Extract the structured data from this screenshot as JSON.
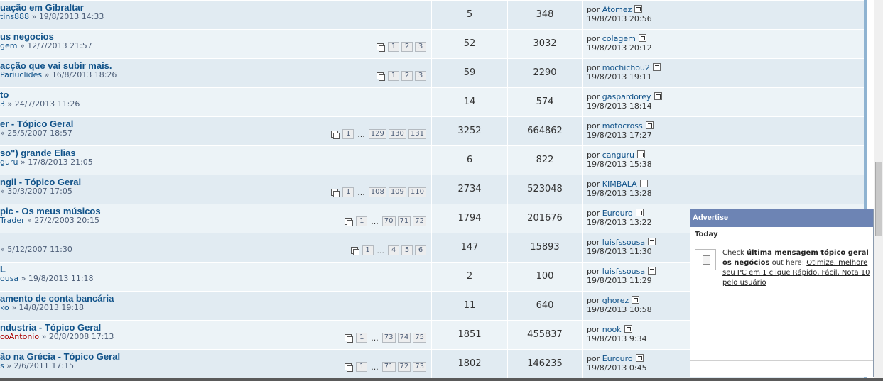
{
  "topics": [
    {
      "title": "uação em Gibraltar",
      "author": "tins888",
      "date": "19/8/2013 14:33",
      "pages": [],
      "replies": "5",
      "views": "348",
      "last_user": "Atomez",
      "last_time": "19/8/2013 20:56"
    },
    {
      "title": "us negocios",
      "author": "gem",
      "date": "12/7/2013 21:57",
      "pages": [
        "1",
        "2",
        "3"
      ],
      "replies": "52",
      "views": "3032",
      "last_user": "colagem",
      "last_time": "19/8/2013 20:12"
    },
    {
      "title": "acção que vai subir mais.",
      "author": "Pariuclides",
      "date": "16/8/2013 18:26",
      "pages": [
        "1",
        "2",
        "3"
      ],
      "replies": "59",
      "views": "2290",
      "last_user": "mochichou2",
      "last_time": "19/8/2013 19:11"
    },
    {
      "title": "to",
      "author": "3",
      "date": "24/7/2013 11:26",
      "pages": [],
      "replies": "14",
      "views": "574",
      "last_user": "gaspardorey",
      "last_time": "19/8/2013 18:14"
    },
    {
      "title": "er - Tópico Geral",
      "author": "",
      "date": "25/5/2007 18:57",
      "pages": [
        "1",
        "...",
        "129",
        "130",
        "131"
      ],
      "replies": "3252",
      "views": "664862",
      "last_user": "motocross",
      "last_time": "19/8/2013 17:27"
    },
    {
      "title": "so\") grande Elias",
      "author": "guru",
      "date": "17/8/2013 21:05",
      "pages": [],
      "replies": "6",
      "views": "822",
      "last_user": "canguru",
      "last_time": "19/8/2013 15:38"
    },
    {
      "title": "ngil - Tópico Geral",
      "author": "",
      "date": "30/3/2007 17:05",
      "pages": [
        "1",
        "...",
        "108",
        "109",
        "110"
      ],
      "replies": "2734",
      "views": "523048",
      "last_user": "KIMBALA",
      "last_time": "19/8/2013 13:28"
    },
    {
      "title": "pic - Os meus músicos",
      "author": "Trader",
      "date": "27/2/2003 20:15",
      "pages": [
        "1",
        "...",
        "70",
        "71",
        "72"
      ],
      "replies": "1794",
      "views": "201676",
      "last_user": "Eurouro",
      "last_time": "19/8/2013 13:22"
    },
    {
      "title": "",
      "author": "",
      "date": "5/12/2007 11:30",
      "pages": [
        "1",
        "...",
        "4",
        "5",
        "6"
      ],
      "replies": "147",
      "views": "15893",
      "last_user": "luisfssousa",
      "last_time": "19/8/2013 11:30"
    },
    {
      "title": "L",
      "author": "ousa",
      "date": "19/8/2013 11:18",
      "pages": [],
      "replies": "2",
      "views": "100",
      "last_user": "luisfssousa",
      "last_time": "19/8/2013 11:29"
    },
    {
      "title": "amento de conta bancária",
      "author": "ko",
      "date": "14/8/2013 19:18",
      "pages": [],
      "replies": "11",
      "views": "640",
      "last_user": "ghorez",
      "last_time": "19/8/2013 10:58"
    },
    {
      "title": "ndustria - Tópico Geral",
      "author": "coAntonio",
      "author_red": true,
      "date": "20/8/2008 17:13",
      "pages": [
        "1",
        "...",
        "73",
        "74",
        "75"
      ],
      "replies": "1851",
      "views": "455837",
      "last_user": "nook",
      "last_time": "19/8/2013 9:34"
    },
    {
      "title": "ão na Grécia - Tópico Geral",
      "author": "s",
      "date": "2/6/2011 17:15",
      "pages": [
        "1",
        "...",
        "71",
        "72",
        "73"
      ],
      "replies": "1802",
      "views": "146235",
      "last_user": "Eurouro",
      "last_time": "19/8/2013 0:45"
    }
  ],
  "labels": {
    "by": "por",
    "sep": "»"
  },
  "advert": {
    "header": "Advertise",
    "today": "Today",
    "text_pre": "Check ",
    "text_bold": "última mensagem tópico geral os negócios",
    "text_mid": " out here: ",
    "link": "Otimize, melhore seu PC em 1 clique Rápido, Fácil, Nota 10 pelo usuário"
  },
  "colors": {
    "row": "#e1ebf2",
    "row_alt": "#ecf3f7",
    "title": "#105289",
    "advert_header": "#6d84b4"
  }
}
